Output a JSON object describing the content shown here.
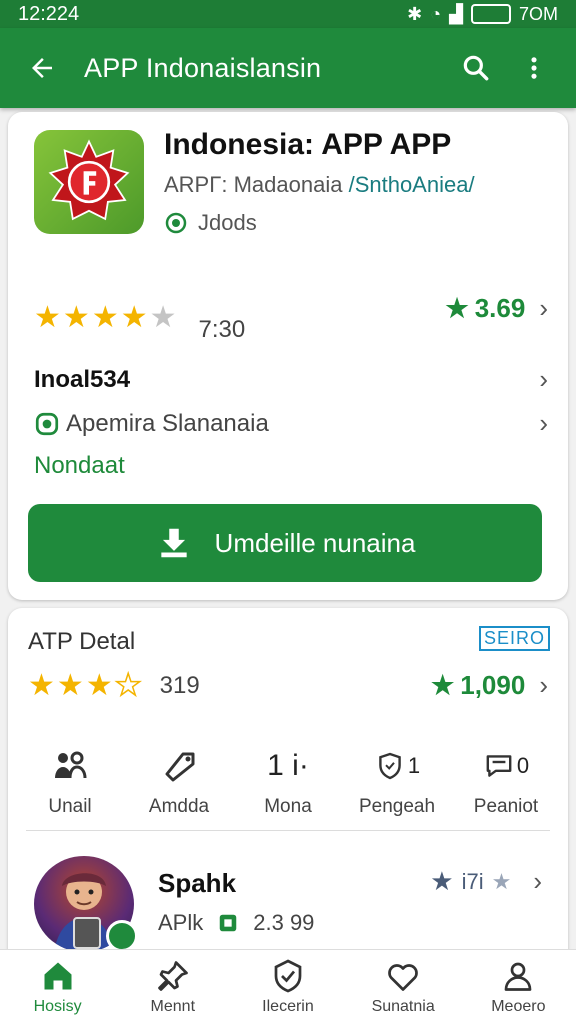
{
  "status": {
    "time": "12:224",
    "right": "7OM"
  },
  "appbar": {
    "title": "APP Indonaislansin"
  },
  "app": {
    "name": "Indonesia: APP APP",
    "sub_prefix": "ARPΓ: Madaonaia",
    "sub_link": "/SnthoAniea/",
    "tag": "Jdods",
    "rating_count": "7:30",
    "score": "3.69",
    "line1": "Inoal534",
    "line2": "Apemira Slananaia",
    "status_text": "Nondaat",
    "install_label": "Umdeille nunaina"
  },
  "detail": {
    "title": "ATP Detal",
    "badge": "SEIRO",
    "rating_count": "319",
    "score": "1,090",
    "features": [
      {
        "value": "",
        "label": "Unail"
      },
      {
        "value": "",
        "label": "Amdda"
      },
      {
        "value": "1 i·",
        "label": "Mona"
      },
      {
        "value": "1",
        "label": "Pengeah"
      },
      {
        "value": "0",
        "label": "Peaniot"
      }
    ],
    "rec": {
      "name": "Spahk",
      "sub": "APlk",
      "size": "2.3 99",
      "score": "i7i"
    }
  },
  "nav": [
    {
      "label": "Hosisy",
      "icon": "home-icon"
    },
    {
      "label": "Mennt",
      "icon": "pin-icon"
    },
    {
      "label": "Ilecerin",
      "icon": "shield-icon"
    },
    {
      "label": "Sunatnia",
      "icon": "heart-icon"
    },
    {
      "label": "Meoero",
      "icon": "person-icon"
    }
  ],
  "colors": {
    "primary": "#1f8a3c",
    "star": "#f4b400",
    "link": "#1a7c80"
  }
}
